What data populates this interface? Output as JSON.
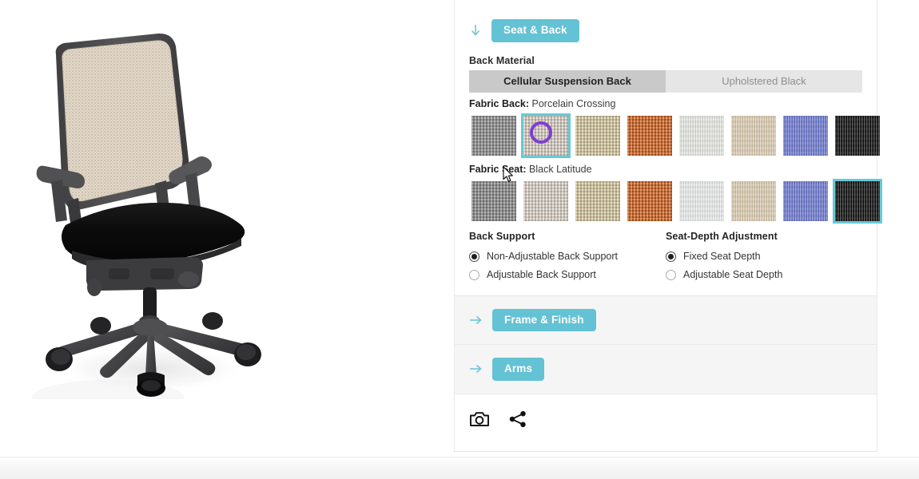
{
  "product_viewer": {
    "alt": "office task chair with porcelain fabric back and black seat",
    "back_fabric_color": "#e4d9c9",
    "seat_color": "#0d0d0d",
    "frame_color": "#4a4a4c"
  },
  "panel": {
    "sections": [
      {
        "id": "seat-and-back",
        "label": "Seat & Back",
        "state": "expanded",
        "arrow": "down-arrow-icon"
      },
      {
        "id": "frame-and-finish",
        "label": "Frame & Finish",
        "state": "collapsed",
        "arrow": "right-arrow-icon"
      },
      {
        "id": "arms",
        "label": "Arms",
        "state": "collapsed",
        "arrow": "right-arrow-icon"
      }
    ],
    "back_material": {
      "label": "Back Material",
      "options": [
        {
          "label": "Cellular Suspension Back",
          "selected": true
        },
        {
          "label": "Upholstered Black",
          "selected": false
        }
      ]
    },
    "fabric_back": {
      "label": "Fabric Back:",
      "value": "Porcelain Crossing",
      "selected_index": 1,
      "swatches": [
        {
          "name": "gray-crossing",
          "color": "#8e8e8e",
          "texture": "basket"
        },
        {
          "name": "porcelain-crossing",
          "color": "#ddd3c6",
          "texture": "basket"
        },
        {
          "name": "wheat-crossing",
          "color": "#d8cba0",
          "texture": "basket"
        },
        {
          "name": "orange-crossing",
          "color": "#d2601b",
          "texture": "basket"
        },
        {
          "name": "white-rib",
          "color": "#e9eae4",
          "texture": "rib"
        },
        {
          "name": "sand-rib",
          "color": "#ddceb2",
          "texture": "rib"
        },
        {
          "name": "periwinkle-rib",
          "color": "#6a77cf",
          "texture": "rib"
        },
        {
          "name": "black-rib",
          "color": "#0b0b0b",
          "texture": "rib"
        }
      ]
    },
    "fabric_seat": {
      "label": "Fabric Seat:",
      "value": "Black Latitude",
      "selected_index": 7,
      "swatches": [
        {
          "name": "gray-crossing",
          "color": "#8a8a8a",
          "texture": "basket"
        },
        {
          "name": "porcelain-crossing",
          "color": "#ded5cb",
          "texture": "basket"
        },
        {
          "name": "wheat-crossing",
          "color": "#d8cba0",
          "texture": "basket"
        },
        {
          "name": "orange-crossing",
          "color": "#d2601b",
          "texture": "basket"
        },
        {
          "name": "white-rib",
          "color": "#eceded",
          "texture": "rib"
        },
        {
          "name": "sand-rib",
          "color": "#dccdb1",
          "texture": "rib"
        },
        {
          "name": "periwinkle-rib",
          "color": "#6a77cf",
          "texture": "rib"
        },
        {
          "name": "black-latitude",
          "color": "#0a0a0a",
          "texture": "rib"
        }
      ]
    },
    "back_support": {
      "title": "Back Support",
      "options": [
        {
          "label": "Non-Adjustable Back Support",
          "selected": true
        },
        {
          "label": "Adjustable Back Support",
          "selected": false
        }
      ]
    },
    "seat_depth": {
      "title": "Seat-Depth Adjustment",
      "options": [
        {
          "label": "Fixed Seat Depth",
          "selected": true
        },
        {
          "label": "Adjustable Seat Depth",
          "selected": false
        }
      ]
    },
    "toolbar": {
      "screenshot": "camera-icon",
      "share": "share-icon"
    }
  },
  "theme": {
    "accent": "#63c2d4",
    "selection_border": "#66c9d8",
    "cursor_ring": "#7e3fd0",
    "segment_active_bg": "#c9c9c9",
    "segment_inactive_bg": "#e6e6e6",
    "collapsed_bg": "#f5f5f5"
  }
}
